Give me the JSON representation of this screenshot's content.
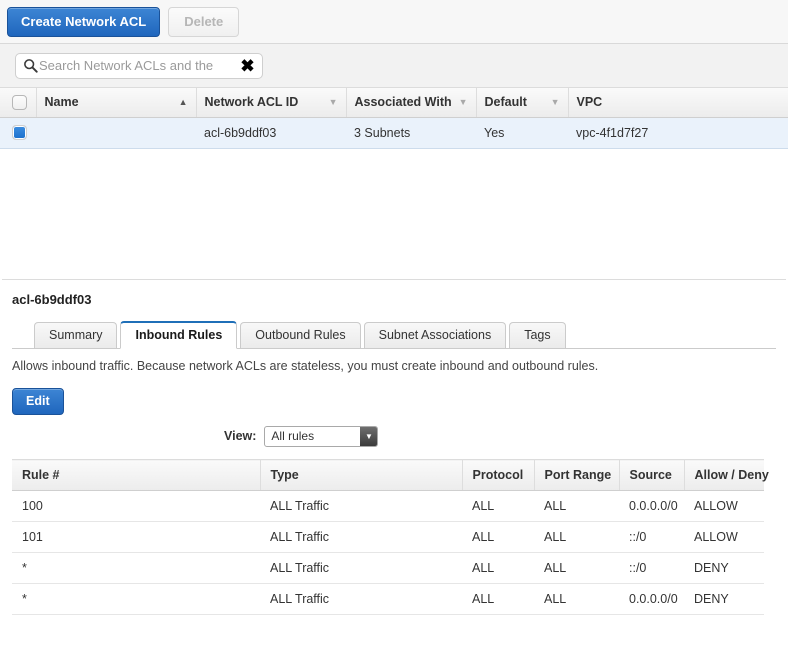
{
  "toolbar": {
    "create_label": "Create Network ACL",
    "delete_label": "Delete"
  },
  "search": {
    "placeholder": "Search Network ACLs and the",
    "value": "",
    "clear_glyph": "✖"
  },
  "list_table": {
    "columns": [
      {
        "label": "Name",
        "sort": "asc"
      },
      {
        "label": "Network ACL ID",
        "sort": "none"
      },
      {
        "label": "Associated With",
        "sort": "none"
      },
      {
        "label": "Default",
        "sort": "none"
      },
      {
        "label": "VPC",
        "sort": "none"
      }
    ],
    "rows": [
      {
        "selected": true,
        "name": "",
        "acl_id": "acl-6b9ddf03",
        "associated_with": "3 Subnets",
        "default": "Yes",
        "vpc": "vpc-4f1d7f27"
      }
    ]
  },
  "detail": {
    "title": "acl-6b9ddf03",
    "tabs": [
      {
        "label": "Summary",
        "active": false
      },
      {
        "label": "Inbound Rules",
        "active": true
      },
      {
        "label": "Outbound Rules",
        "active": false
      },
      {
        "label": "Subnet Associations",
        "active": false
      },
      {
        "label": "Tags",
        "active": false
      }
    ],
    "description": "Allows inbound traffic. Because network ACLs are stateless, you must create inbound and outbound rules.",
    "edit_label": "Edit",
    "view_label": "View:",
    "view_value": "All rules"
  },
  "rules_table": {
    "columns": [
      "Rule #",
      "Type",
      "Protocol",
      "Port Range",
      "Source",
      "Allow / Deny"
    ],
    "rows": [
      {
        "rule": "100",
        "type": "ALL Traffic",
        "protocol": "ALL",
        "port_range": "ALL",
        "source": "0.0.0.0/0",
        "action": "ALLOW"
      },
      {
        "rule": "101",
        "type": "ALL Traffic",
        "protocol": "ALL",
        "port_range": "ALL",
        "source": "::/0",
        "action": "ALLOW"
      },
      {
        "rule": "*",
        "type": "ALL Traffic",
        "protocol": "ALL",
        "port_range": "ALL",
        "source": "::/0",
        "action": "DENY"
      },
      {
        "rule": "*",
        "type": "ALL Traffic",
        "protocol": "ALL",
        "port_range": "ALL",
        "source": "0.0.0.0/0",
        "action": "DENY"
      }
    ]
  },
  "colors": {
    "primary_button": "#1f66bd",
    "allow": "#2f8b30",
    "deny": "#cf3a2e",
    "active_tab_border": "#1f6fb8",
    "selected_row": "#eaf2fb"
  }
}
